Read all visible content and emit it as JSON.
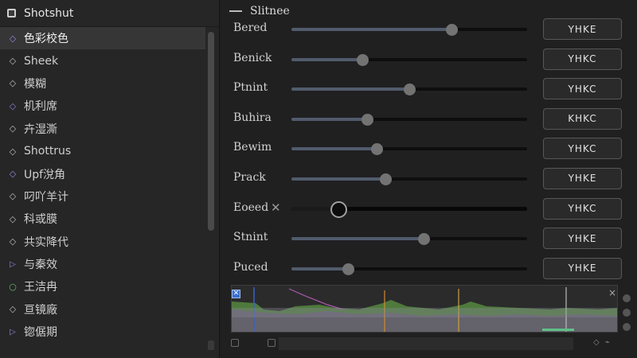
{
  "app": {
    "title": "Shotshut"
  },
  "list": {
    "items": [
      {
        "label": "色彩校色",
        "icon": "diamond-icon",
        "icon_color": "#9a86d8",
        "selected": true
      },
      {
        "label": "Sheek",
        "icon": "diamond-icon",
        "icon_color": "#bdbdbd"
      },
      {
        "label": "模糊",
        "icon": "diamond-icon",
        "icon_color": "#bdbdbd"
      },
      {
        "label": "机利席",
        "icon": "diamond-icon",
        "icon_color": "#8f7fd0"
      },
      {
        "label": "卉湿澌",
        "icon": "diamond-icon",
        "icon_color": "#bdbdbd"
      },
      {
        "label": "Shottrus",
        "icon": "diamond-icon",
        "icon_color": "#bdbdbd"
      },
      {
        "label": "Upf涗角",
        "icon": "diamond-icon",
        "icon_color": "#9a86d8"
      },
      {
        "label": "叼吖羊计",
        "icon": "diamond-icon",
        "icon_color": "#bdbdbd"
      },
      {
        "label": "科或膜",
        "icon": "diamond-icon",
        "icon_color": "#bdbdbd"
      },
      {
        "label": "共实降代",
        "icon": "diamond-icon",
        "icon_color": "#bdbdbd"
      },
      {
        "label": "与秦效",
        "icon": "triangle-icon",
        "icon_color": "#9a86d8"
      },
      {
        "label": "王洁冉",
        "icon": "circle-icon",
        "icon_color": "#6cb46c"
      },
      {
        "label": "亘镜廠",
        "icon": "diamond-icon",
        "icon_color": "#bdbdbd"
      },
      {
        "label": "锪倨期",
        "icon": "triangle-icon",
        "icon_color": "#9a86d8"
      }
    ]
  },
  "section": {
    "title": "Slitnee"
  },
  "params": [
    {
      "label": "Bered",
      "value": 0.68,
      "button": "YHKE",
      "fill_color": "#515b6c"
    },
    {
      "label": "Benick",
      "value": 0.3,
      "button": "YHKC",
      "fill_color": "#515b6c"
    },
    {
      "label": "Ptnint",
      "value": 0.5,
      "button": "YHKC",
      "fill_color": "#515b6c"
    },
    {
      "label": "Buhira",
      "value": 0.32,
      "button": "KHKC",
      "fill_color": "#515b6c"
    },
    {
      "label": "Bewim",
      "value": 0.36,
      "button": "YHKC",
      "fill_color": "#515b6c"
    },
    {
      "label": "Prack",
      "value": 0.4,
      "button": "YHKE",
      "fill_color": "#515b6c"
    },
    {
      "label": "Eoeed",
      "value": 0.2,
      "button": "YHKC",
      "active": true,
      "close": "✕"
    },
    {
      "label": "Stnint",
      "value": 0.56,
      "button": "YHKE",
      "fill_color": "#515b6c"
    },
    {
      "label": "Puced",
      "value": 0.24,
      "button": "YHKE",
      "fill_color": "#515b6c"
    }
  ],
  "waveform": {
    "check": "✕",
    "close": "×",
    "bottom_icons": "◇ ⌁"
  }
}
